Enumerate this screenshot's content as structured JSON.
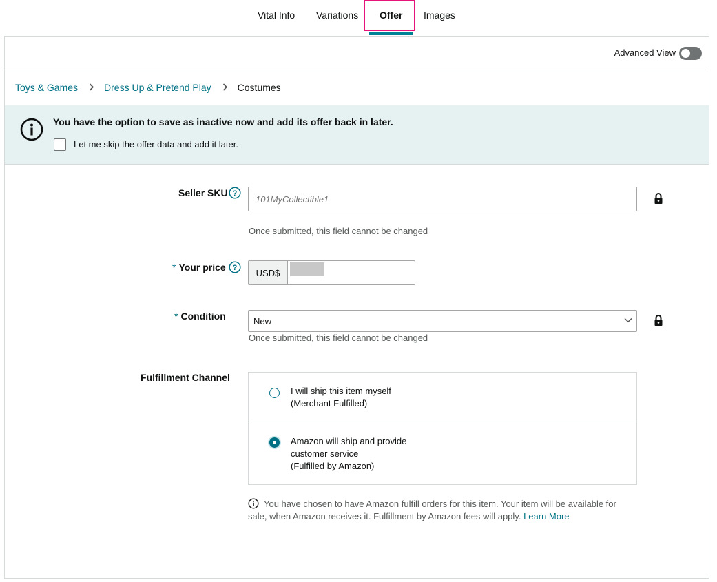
{
  "tabs": [
    {
      "label": "Vital Info"
    },
    {
      "label": "Variations"
    },
    {
      "label": "Offer"
    },
    {
      "label": "Images"
    }
  ],
  "advanced_view": {
    "label": "Advanced View",
    "enabled": false
  },
  "breadcrumb": {
    "items": [
      "Toys & Games",
      "Dress Up & Pretend Play",
      "Costumes"
    ],
    "separator": ">"
  },
  "banner": {
    "title": "You have the option to save as inactive now and add its offer back in later.",
    "checkbox_label": "Let me skip the offer data and add it later.",
    "checked": false
  },
  "seller_sku": {
    "label": "Seller SKU",
    "placeholder": "101MyCollectible1",
    "hint": "Once submitted, this field cannot be changed"
  },
  "your_price": {
    "label": "Your price",
    "required_mark": "*",
    "currency": "USD$"
  },
  "condition": {
    "label": "Condition",
    "required_mark": "*",
    "selected": "New",
    "hint": "Once submitted, this field cannot be changed"
  },
  "fulfillment": {
    "label": "Fulfillment Channel",
    "options": [
      {
        "lines": [
          "I will ship this item myself",
          "(Merchant Fulfilled)"
        ],
        "selected": false
      },
      {
        "lines": [
          "Amazon will ship and provide",
          "customer service",
          "(Fulfilled by Amazon)"
        ],
        "selected": true
      }
    ],
    "note": "You have chosen to have Amazon fulfill orders for this item. Your item will be available for sale, when Amazon receives it. Fulfillment by Amazon fees will apply.",
    "learn_more": "Learn More"
  },
  "colors": {
    "accent": "#007185",
    "highlight": "#e5137a",
    "banner_bg": "#e6f1f2"
  }
}
